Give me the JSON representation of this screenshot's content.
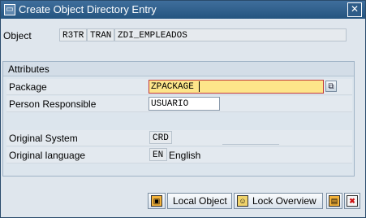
{
  "window": {
    "title": "Create Object Directory Entry",
    "close_glyph": "✕",
    "system_icon_glyph": "▭"
  },
  "object": {
    "label": "Object",
    "pgmid": "R3TR",
    "type": "TRAN",
    "name": "ZDI_EMPLEADOS"
  },
  "attributes": {
    "group_title": "Attributes",
    "package_label": "Package",
    "package_value": "ZPACKAGE",
    "person_label": "Person Responsible",
    "person_value": "USUARIO",
    "original_system_label": "Original System",
    "original_system_value": "CRD",
    "original_language_label": "Original language",
    "original_language_code": "EN",
    "original_language_text": "English"
  },
  "footer": {
    "save_glyph": "▣",
    "local_object_label": "Local Object",
    "lock_overview_label": "Lock Overview",
    "lock_overview_glyph": "☺",
    "save_only_glyph": "▤",
    "cancel_glyph": "✖"
  },
  "colors": {
    "titlebar": "#24547f",
    "required_field_bg": "#fde58a",
    "required_border": "#c23a3a",
    "cancel_icon": "#cc1111"
  }
}
